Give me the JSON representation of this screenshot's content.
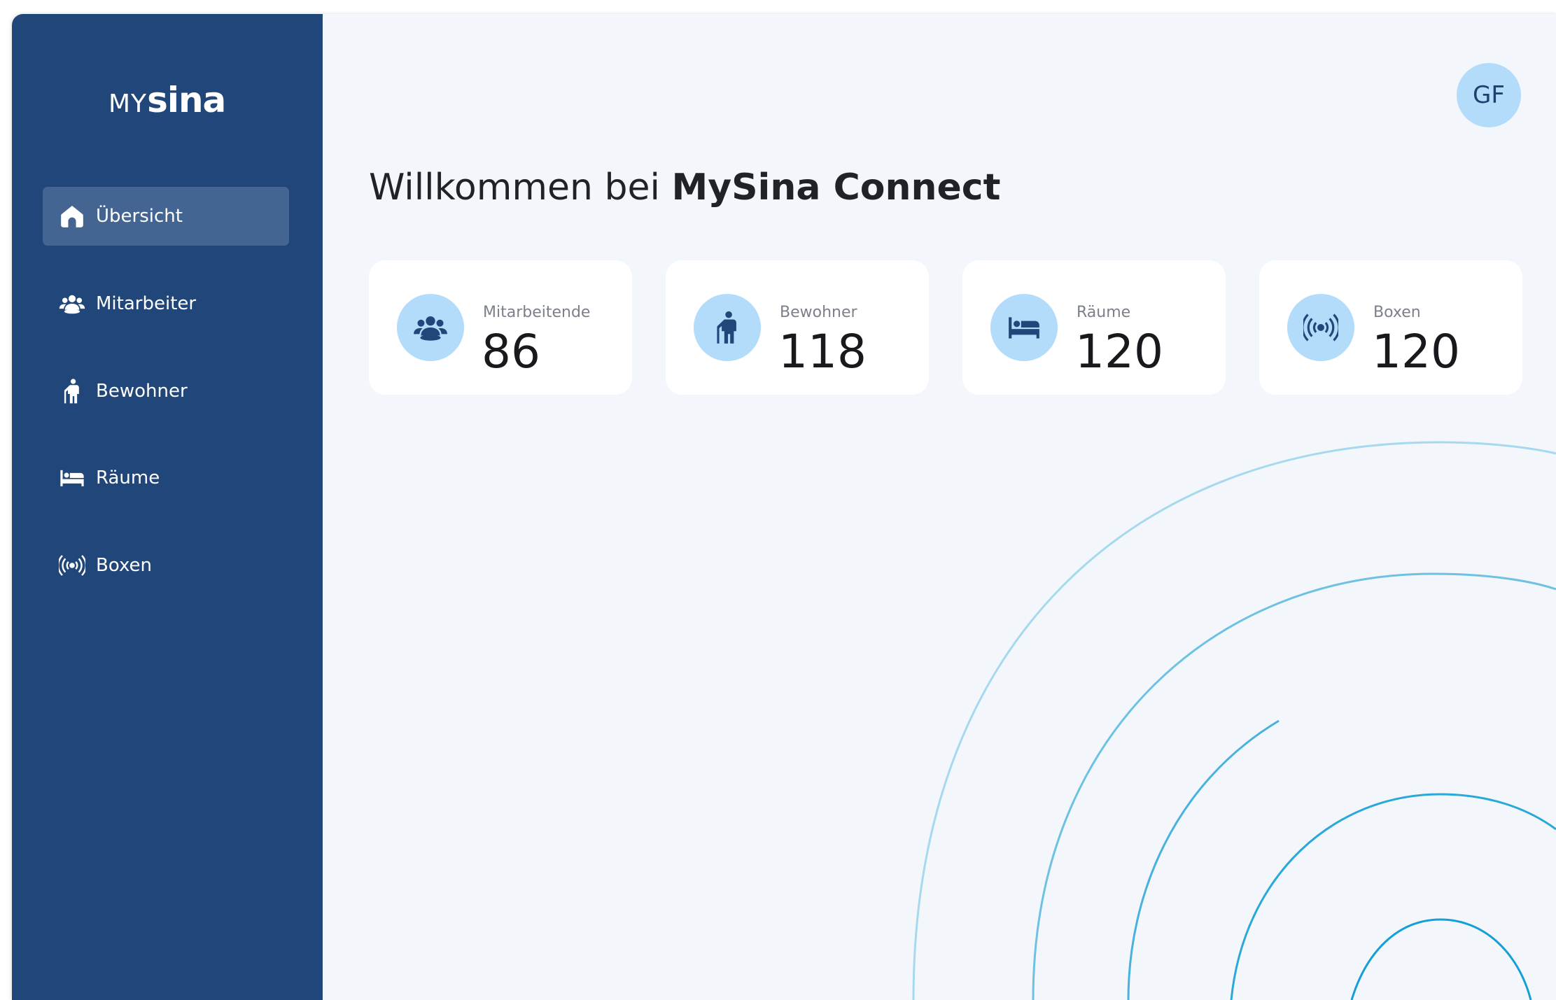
{
  "app": {
    "logo_prefix": "MY",
    "logo_suffix": "sina"
  },
  "sidebar": {
    "items": [
      {
        "label": "Übersicht",
        "icon": "home-icon",
        "active": true
      },
      {
        "label": "Mitarbeiter",
        "icon": "users-icon",
        "active": false
      },
      {
        "label": "Bewohner",
        "icon": "elderly-person-icon",
        "active": false
      },
      {
        "label": "Räume",
        "icon": "bed-icon",
        "active": false
      },
      {
        "label": "Boxen",
        "icon": "signal-broadcast-icon",
        "active": false
      }
    ]
  },
  "header": {
    "avatar_initials": "GF"
  },
  "main": {
    "welcome_prefix": "Willkommen bei ",
    "welcome_brand": "MySina Connect",
    "stats": [
      {
        "label": "Mitarbeitende",
        "value": "86",
        "icon": "users-icon"
      },
      {
        "label": "Bewohner",
        "value": "118",
        "icon": "elderly-person-icon"
      },
      {
        "label": "Räume",
        "value": "120",
        "icon": "bed-icon"
      },
      {
        "label": "Boxen",
        "value": "120",
        "icon": "signal-broadcast-icon"
      }
    ]
  },
  "colors": {
    "sidebar_bg": "#21477a",
    "sidebar_active": "#446591",
    "main_bg": "#f3f7fc",
    "accent_light": "#b3dcfb",
    "accent_dark": "#21477a",
    "arc_color": "#1ea6d8"
  }
}
